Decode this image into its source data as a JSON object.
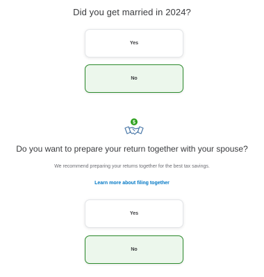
{
  "question1": {
    "title": "Did you get married in 2024?",
    "options": [
      "Yes",
      "No"
    ],
    "selected": "No"
  },
  "question2": {
    "icon": "handshake-dollar-icon",
    "title": "Do you want to prepare your return together with your spouse?",
    "subtitle": "We recommend preparing your returns together for the best tax savings.",
    "link": "Learn more about filing together",
    "options": [
      "Yes",
      "No"
    ],
    "selected": "No"
  },
  "colors": {
    "selected_border": "#2b8a2b",
    "selected_bg": "#ecf7ec",
    "link": "#0077c5",
    "icon_green": "#2ca01c",
    "icon_blue": "#4a78a8"
  }
}
